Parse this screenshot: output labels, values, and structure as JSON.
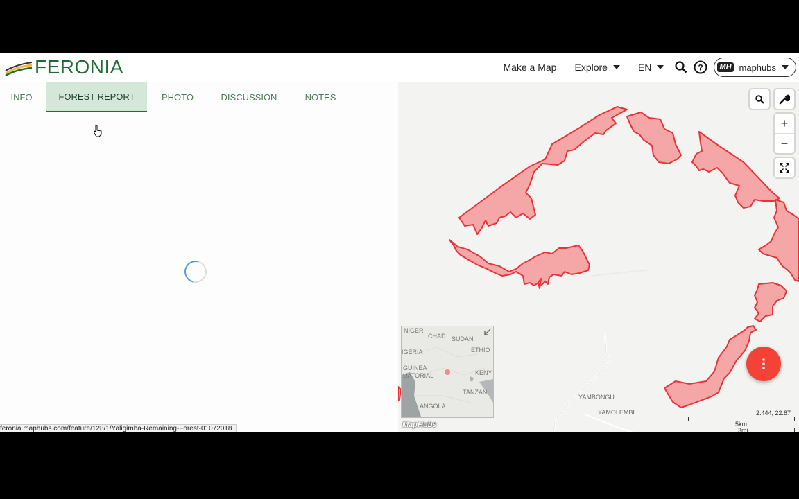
{
  "navbar": {
    "logo_text": "FERONIA",
    "make_map": "Make a Map",
    "explore": "Explore",
    "language": "EN",
    "user_badge": "MH",
    "username": "maphubs"
  },
  "tabs": [
    {
      "label": "INFO"
    },
    {
      "label": "FOREST REPORT"
    },
    {
      "label": "PHOTO"
    },
    {
      "label": "DISCUSSION"
    },
    {
      "label": "NOTES"
    }
  ],
  "active_tab": "FOREST REPORT",
  "map": {
    "minimap_labels": {
      "niger": "NIGER",
      "chad": "CHAD",
      "sudan": "SUDAN",
      "nigeria": "IGERIA",
      "ethiopia": "ETHIO",
      "guinea": "GUINEA",
      "equatorial": "UATORIAL",
      "kenya": "KENY",
      "tanzania": "TANZANI",
      "angola": "ANGOLA"
    },
    "place_labels": {
      "yambongu": "YAMBONGU",
      "yamolembi": "YAMOLEMBI"
    },
    "coordinates": "2.444, 22.87",
    "scale_km": "5km",
    "scale_mi": "3mi",
    "watermark": "MapHubs",
    "feature_fill": "#f5a6a6",
    "feature_stroke": "#e8333a"
  },
  "status_url": "feronia.maphubs.com/feature/128/1/Yaligimba-Remaining-Forest-01072018",
  "colors": {
    "brand_green": "#1f6b36",
    "tab_active_bg": "#d5e7d8",
    "fab_red": "#f44336"
  },
  "icons": {
    "search": "search-icon",
    "help": "help-icon",
    "map_search": "search-icon",
    "tools": "wrench-icon",
    "zoom_in": "plus-icon",
    "zoom_out": "minus-icon",
    "fullscreen": "fullscreen-icon",
    "fab": "more-vertical-icon",
    "minimap_toggle": "arrow-collapse-icon"
  }
}
